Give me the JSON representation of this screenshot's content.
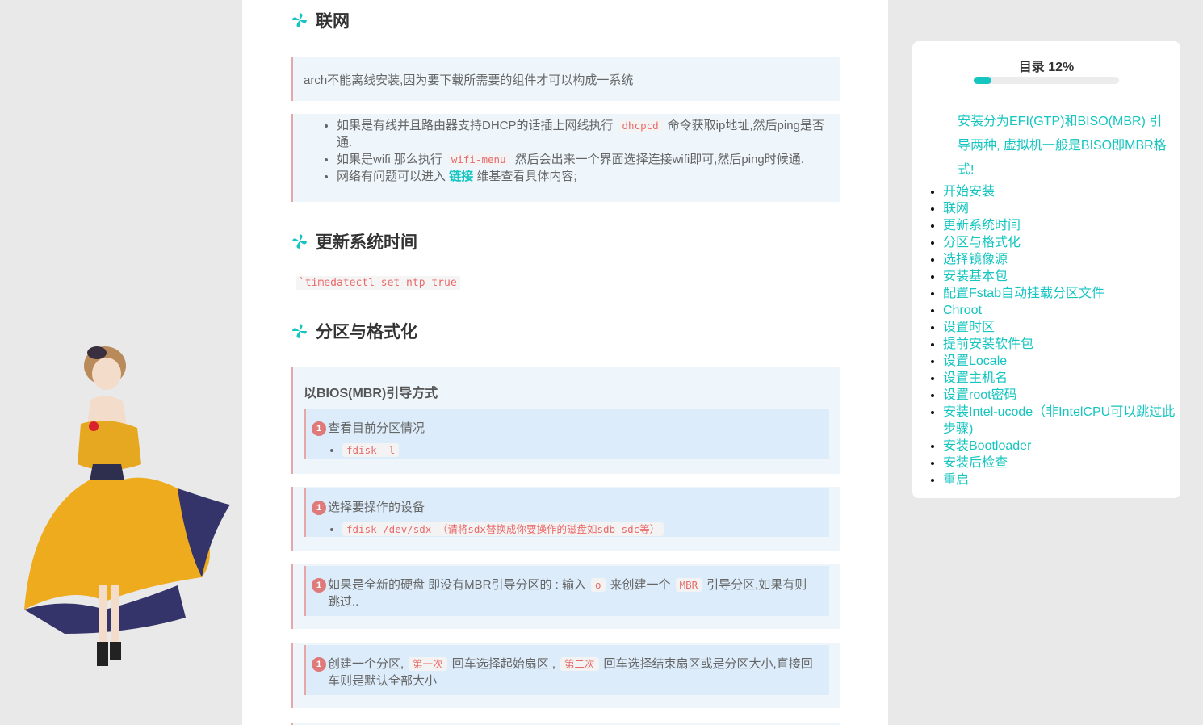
{
  "sections": {
    "network_heading": "联网",
    "network_note": "arch不能离线安装,因为要下载所需要的组件才可以构成一系统",
    "network_items": [
      {
        "pre": "如果是有线并且路由器支持DHCP的话插上网线执行",
        "code": "dhcpcd",
        "post": "命令获取ip地址,然后ping是否通."
      },
      {
        "pre": "如果是wifi 那么执行",
        "code": "wifi-menu",
        "post": "然后会出来一个界面选择连接wifi即可,然后ping时候通."
      },
      {
        "pre": "网络有问题可以进入",
        "link": "链接",
        "post": "维基查看具体内容;"
      }
    ],
    "time_heading": "更新系统时间",
    "time_code": "`timedatectl set-ntp true",
    "partition_heading": "分区与格式化",
    "mbr_title": "以BIOS(MBR)引导方式",
    "steps": [
      {
        "num": "1",
        "text": "查看目前分区情况",
        "code": "fdisk -l"
      },
      {
        "num": "1",
        "text": "选择要操作的设备",
        "code": "fdisk /dev/sdx （请将sdx替换成你要操作的磁盘如sdb sdc等）"
      },
      {
        "num": "1",
        "pre": "如果是全新的硬盘 即没有MBR引导分区的 : 输入",
        "code1": "o",
        "mid": "来创建一个",
        "code2": "MBR",
        "post": "引导分区,如果有则跳过.."
      },
      {
        "num": "1",
        "pre": "创建一个分区,",
        "code1": "第一次",
        "mid": "回车选择起始扇区 ,",
        "code2": "第二次",
        "post": "回车选择结束扇区或是分区大小,直接回车则是默认全部大小"
      }
    ]
  },
  "toc": {
    "title": "目录 12%",
    "progress": 0.12,
    "head_item": "安装分为EFI(GTP)和BISO(MBR) 引导两种, 虚拟机一般是BISO即MBR格式!",
    "items": [
      "开始安装",
      "联网",
      "更新系统时间",
      "分区与格式化",
      "选择镜像源",
      "安装基本包",
      "配置Fstab自动挂载分区文件",
      "Chroot",
      "设置时区",
      "提前安装软件包",
      "设置Locale",
      "设置主机名",
      "设置root密码",
      "安装Intel-ucode（非IntelCPU可以跳过此步骤)",
      "安装Bootloader",
      "安装后检查",
      "重启"
    ]
  },
  "colors": {
    "accent": "#14c5c0",
    "code": "#e96a6a",
    "note_bg": "#eef6fc",
    "note_border": "#e6a7a7"
  }
}
